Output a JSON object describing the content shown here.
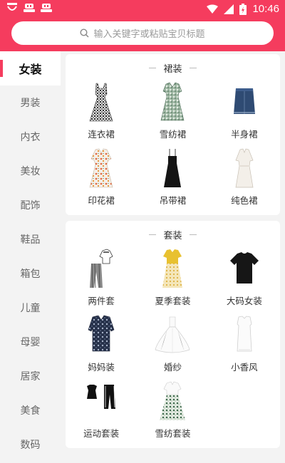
{
  "status": {
    "time": "10:46"
  },
  "search": {
    "placeholder": "输入关键字或粘贴宝贝标题"
  },
  "sidebar": {
    "items": [
      {
        "label": "女装",
        "active": true
      },
      {
        "label": "男装"
      },
      {
        "label": "内衣"
      },
      {
        "label": "美妆"
      },
      {
        "label": "配饰"
      },
      {
        "label": "鞋品"
      },
      {
        "label": "箱包"
      },
      {
        "label": "儿童"
      },
      {
        "label": "母婴"
      },
      {
        "label": "居家"
      },
      {
        "label": "美食"
      },
      {
        "label": "数码"
      }
    ]
  },
  "sections": [
    {
      "title": "裙装",
      "items": [
        {
          "label": "连衣裙",
          "icon": "plaid-dress-icon"
        },
        {
          "label": "雪纺裙",
          "icon": "chiffon-dress-icon"
        },
        {
          "label": "半身裙",
          "icon": "denim-skirt-icon"
        },
        {
          "label": "印花裙",
          "icon": "print-dress-icon"
        },
        {
          "label": "吊带裙",
          "icon": "slip-dress-icon"
        },
        {
          "label": "纯色裙",
          "icon": "solid-dress-icon"
        }
      ]
    },
    {
      "title": "套装",
      "items": [
        {
          "label": "两件套",
          "icon": "two-piece-icon"
        },
        {
          "label": "夏季套装",
          "icon": "summer-set-icon"
        },
        {
          "label": "大码女装",
          "icon": "plus-size-tshirt-icon"
        },
        {
          "label": "妈妈装",
          "icon": "mom-outfit-icon"
        },
        {
          "label": "婚纱",
          "icon": "wedding-dress-icon"
        },
        {
          "label": "小香风",
          "icon": "chanel-style-icon"
        },
        {
          "label": "运动套装",
          "icon": "sport-set-icon"
        },
        {
          "label": "雪纺套装",
          "icon": "chiffon-set-icon"
        }
      ]
    }
  ],
  "colors": {
    "accent": "#f53c5e"
  }
}
